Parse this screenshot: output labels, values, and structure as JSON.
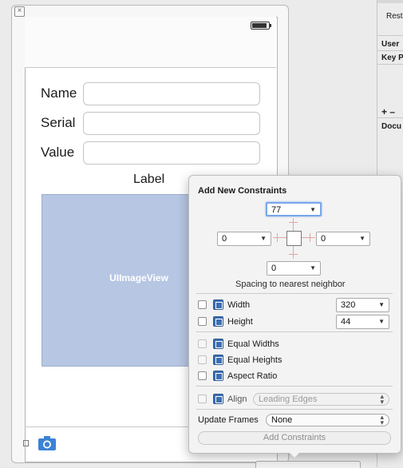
{
  "storyboard": {
    "fields": [
      {
        "label": "Name"
      },
      {
        "label": "Serial"
      },
      {
        "label": "Value"
      }
    ],
    "center_label": "Label",
    "image_view_label": "UIImageView"
  },
  "inspector": {
    "restoration_text": "Resto",
    "user_text": "User",
    "key_text": "Key P",
    "plus_minus": "+  –",
    "document_text": "Docu"
  },
  "popover": {
    "title": "Add New Constraints",
    "top_value": "77",
    "left_value": "0",
    "right_value": "0",
    "bottom_value": "0",
    "spacing_hint": "Spacing to nearest neighbor",
    "width_label": "Width",
    "width_value": "320",
    "height_label": "Height",
    "height_value": "44",
    "equal_widths": "Equal Widths",
    "equal_heights": "Equal Heights",
    "aspect_ratio": "Aspect Ratio",
    "align_label": "Align",
    "align_value": "Leading Edges",
    "update_frames_label": "Update Frames",
    "update_frames_value": "None",
    "add_button": "Add Constraints"
  },
  "colors": {
    "accent": "#3c6fb3",
    "image_view_fill": "#b6c6e3",
    "camera_icon": "#3b82d6"
  }
}
